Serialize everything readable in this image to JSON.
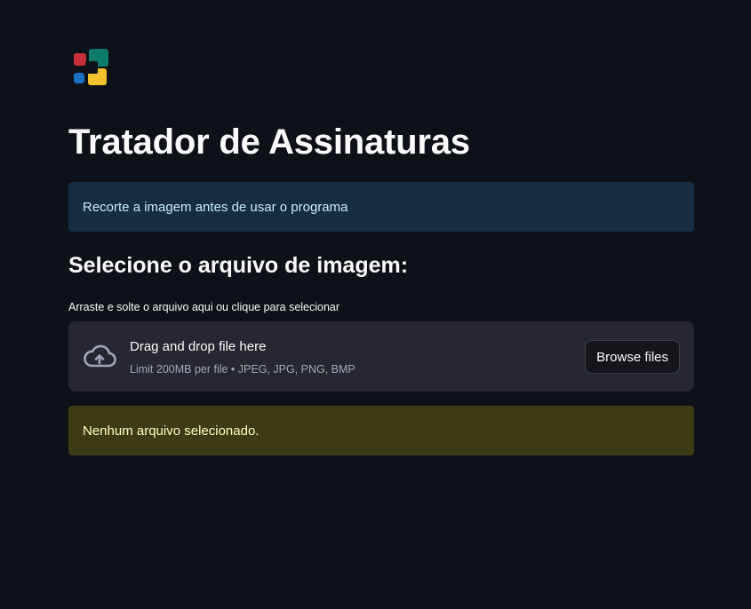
{
  "app": {
    "title": "Tratador de Assinaturas",
    "logo_icon": "app-logo-icon",
    "logo_colors": [
      "#c8303a",
      "#0d7a6a",
      "#1a6fc2",
      "#f2c12e"
    ]
  },
  "info_alert": {
    "text": "Recorte a imagem antes de usar o programa",
    "background": "#172d43",
    "color": "#c7ebff"
  },
  "section": {
    "heading": "Selecione o arquivo de imagem:"
  },
  "uploader": {
    "label": "Arraste e solte o arquivo aqui ou clique para selecionar",
    "drop_text": "Drag and drop file here",
    "limit_text": "Limit 200MB per file • JPEG, JPG, PNG, BMP",
    "browse_label": "Browse files",
    "icon": "cloud-upload-icon"
  },
  "warning_alert": {
    "text": "Nenhum arquivo selecionado.",
    "background": "#3d3a16",
    "color": "#ffffc2"
  }
}
